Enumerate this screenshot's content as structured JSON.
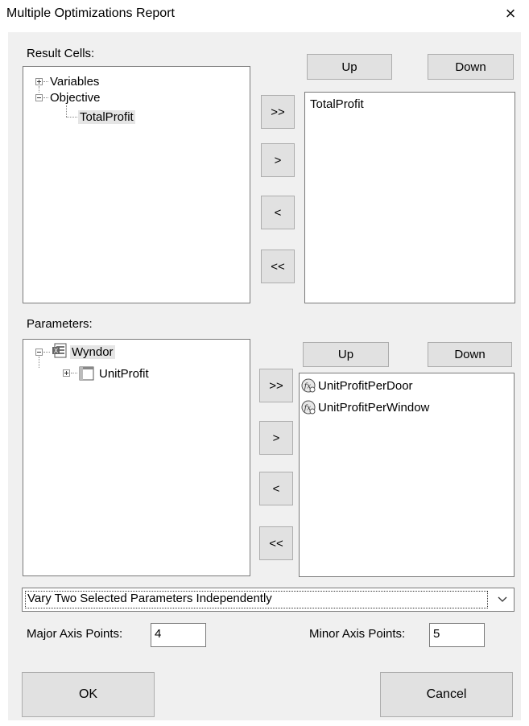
{
  "window": {
    "title": "Multiple Optimizations Report",
    "close_glyph": "×"
  },
  "result_cells": {
    "label": "Result Cells:",
    "tree": {
      "variables": "Variables",
      "objective": "Objective",
      "total_profit": "TotalProfit"
    },
    "up_label": "Up",
    "down_label": "Down",
    "move_all_right": ">>",
    "move_right": ">",
    "move_left": "<",
    "move_all_left": "<<",
    "selected_items": [
      "TotalProfit"
    ]
  },
  "parameters": {
    "label": "Parameters:",
    "tree": {
      "model": "Wyndor",
      "unit_profit": "UnitProfit"
    },
    "up_label": "Up",
    "down_label": "Down",
    "move_all_right": ">>",
    "move_right": ">",
    "move_left": "<",
    "move_all_left": "<<",
    "selected_items": [
      "UnitProfitPerDoor",
      "UnitProfitPerWindow"
    ]
  },
  "mode": {
    "selected": "Vary Two Selected Parameters Independently"
  },
  "axis": {
    "major_label": "Major Axis Points:",
    "major_value": "4",
    "minor_label": "Minor Axis Points:",
    "minor_value": "5"
  },
  "actions": {
    "ok_label": "OK",
    "cancel_label": "Cancel"
  }
}
